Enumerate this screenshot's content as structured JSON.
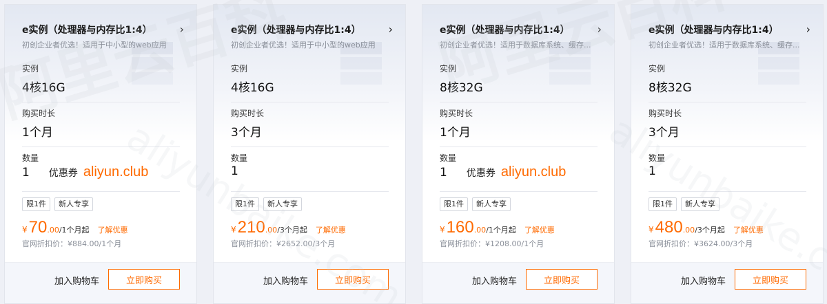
{
  "cards": [
    {
      "title": "e实例（处理器与内存比1:4）",
      "subtitle": "初创企业者优选！适用于中小型的web应用",
      "instance_label": "实例",
      "instance_value": "4核16G",
      "duration_label": "购买时长",
      "duration_value": "1个月",
      "qty_label": "数量",
      "qty_value": "1",
      "coupon_label": "优惠券",
      "coupon_code": "aliyun.club",
      "tags": [
        "限1件",
        "新人专享"
      ],
      "currency": "¥",
      "price_int": "70",
      "price_dec": ".00",
      "price_unit": "/1个月起",
      "learn_more": "了解优惠",
      "orig_price": "官网折扣价：¥884.00/1个月",
      "add_cart": "加入购物车",
      "buy": "立即购买"
    },
    {
      "title": "e实例（处理器与内存比1:4）",
      "subtitle": "初创企业者优选！适用于中小型的web应用",
      "instance_label": "实例",
      "instance_value": "4核16G",
      "duration_label": "购买时长",
      "duration_value": "3个月",
      "qty_label": "数量",
      "qty_value": "1",
      "coupon_label": "",
      "coupon_code": "",
      "tags": [
        "限1件",
        "新人专享"
      ],
      "currency": "¥",
      "price_int": "210",
      "price_dec": ".00",
      "price_unit": "/3个月起",
      "learn_more": "了解优惠",
      "orig_price": "官网折扣价：¥2652.00/3个月",
      "add_cart": "加入购物车",
      "buy": "立即购买"
    },
    {
      "title": "e实例（处理器与内存比1:4）",
      "subtitle": "初创企业者优选！适用于数据库系统、缓存...",
      "instance_label": "实例",
      "instance_value": "8核32G",
      "duration_label": "购买时长",
      "duration_value": "1个月",
      "qty_label": "数量",
      "qty_value": "1",
      "coupon_label": "优惠券",
      "coupon_code": "aliyun.club",
      "tags": [
        "限1件",
        "新人专享"
      ],
      "currency": "¥",
      "price_int": "160",
      "price_dec": ".00",
      "price_unit": "/1个月起",
      "learn_more": "了解优惠",
      "orig_price": "官网折扣价：¥1208.00/1个月",
      "add_cart": "加入购物车",
      "buy": "立即购买"
    },
    {
      "title": "e实例（处理器与内存比1:4）",
      "subtitle": "初创企业者优选！适用于数据库系统、缓存...",
      "instance_label": "实例",
      "instance_value": "8核32G",
      "duration_label": "购买时长",
      "duration_value": "3个月",
      "qty_label": "数量",
      "qty_value": "1",
      "coupon_label": "",
      "coupon_code": "",
      "tags": [
        "限1件",
        "新人专享"
      ],
      "currency": "¥",
      "price_int": "480",
      "price_dec": ".00",
      "price_unit": "/3个月起",
      "learn_more": "了解优惠",
      "orig_price": "官网折扣价：¥3624.00/3个月",
      "add_cart": "加入购物车",
      "buy": "立即购买"
    }
  ],
  "watermark": {
    "cn_text": "阿里云百科",
    "en_text": "aliyunbaike.com"
  },
  "colors": {
    "accent": "#ff6a00",
    "muted": "#8a8f99"
  },
  "icons": {
    "detail": "chevron-right-icon"
  }
}
